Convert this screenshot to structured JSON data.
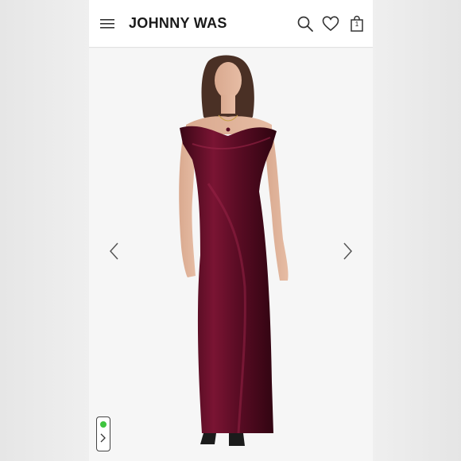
{
  "app": {
    "brand_name": "JOHNNY WAS",
    "cart_count": "1"
  },
  "header": {
    "icons": [
      "menu-icon",
      "search-icon",
      "heart-icon",
      "shopping-bag-icon"
    ]
  },
  "gallery": {
    "icons": [
      "chevron-left-icon",
      "chevron-right-icon"
    ],
    "product_color": "#6e0f2c"
  },
  "chat": {
    "status_color": "#3ec43e",
    "icons": [
      "chevron-right-icon"
    ]
  }
}
